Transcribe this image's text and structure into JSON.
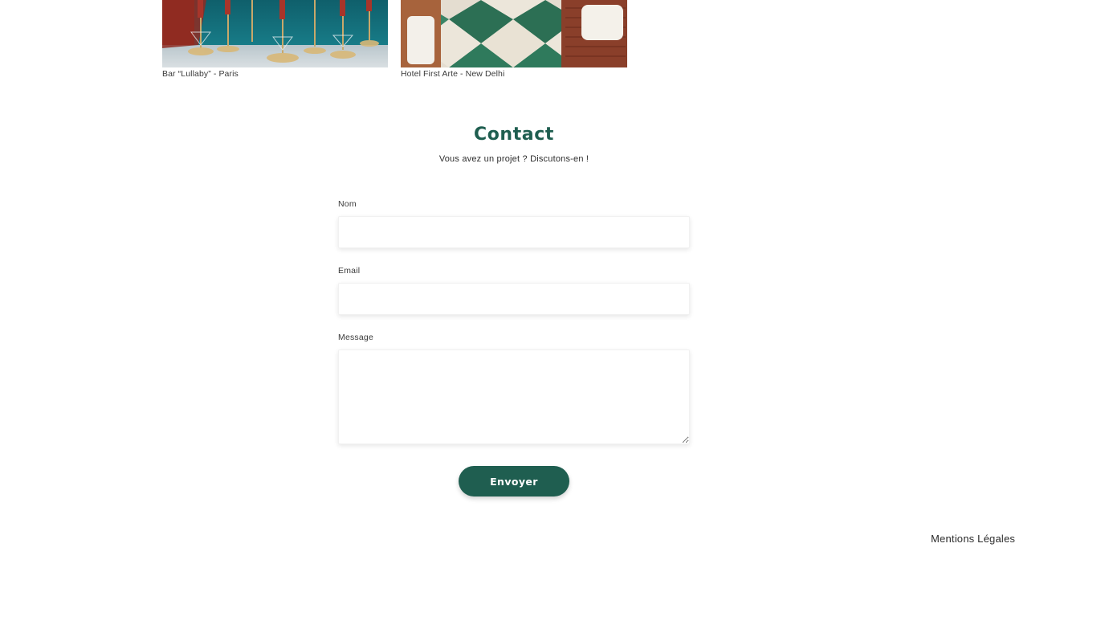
{
  "gallery": {
    "items": [
      {
        "caption": "Bar “Lullaby” - Paris"
      },
      {
        "caption": "Hotel First Arte - New Delhi"
      }
    ]
  },
  "contact": {
    "title": "Contact",
    "subtitle": "Vous avez un projet ? Discutons-en !",
    "fields": {
      "name_label": "Nom",
      "name_value": "",
      "email_label": "Email",
      "email_value": "",
      "message_label": "Message",
      "message_value": ""
    },
    "submit_label": "Envoyer"
  },
  "footer": {
    "legal_label": "Mentions Légales"
  },
  "colors": {
    "accent": "#1f5e50",
    "background": "#ffffff",
    "text": "#2b2b2b"
  }
}
